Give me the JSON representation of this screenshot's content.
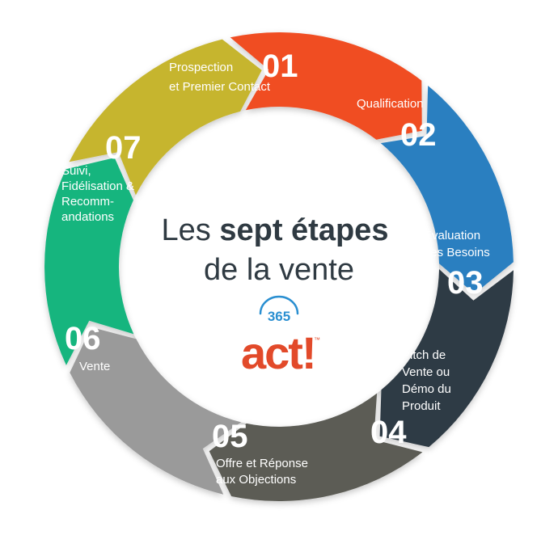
{
  "title": {
    "line1_regular": "Les ",
    "line1_bold": "sept étapes",
    "line2": "de la vente"
  },
  "brand": {
    "badge": "365",
    "wordmark": "act!",
    "tm": "™"
  },
  "steps": [
    {
      "num": "01",
      "lines": [
        "Prospection",
        "et Premier Contact"
      ],
      "color": "#f04e23"
    },
    {
      "num": "02",
      "lines": [
        "Qualification"
      ],
      "color": "#2a7fc0"
    },
    {
      "num": "03",
      "lines": [
        "Évaluation",
        "des Besoins"
      ],
      "color": "#2f3a44"
    },
    {
      "num": "04",
      "lines": [
        "Pitch de",
        "Vente ou",
        "Démo du",
        "Produit"
      ],
      "color": "#5b5c54"
    },
    {
      "num": "05",
      "lines": [
        "Offre et Réponse",
        "aux Objections"
      ],
      "color": "#9a9a9a"
    },
    {
      "num": "06",
      "lines": [
        "Vente"
      ],
      "color": "#14b57e"
    },
    {
      "num": "07",
      "lines": [
        "Suivi,",
        "Fidélisation &",
        "Recomm-",
        "andations"
      ],
      "color": "#c6b52f"
    }
  ]
}
